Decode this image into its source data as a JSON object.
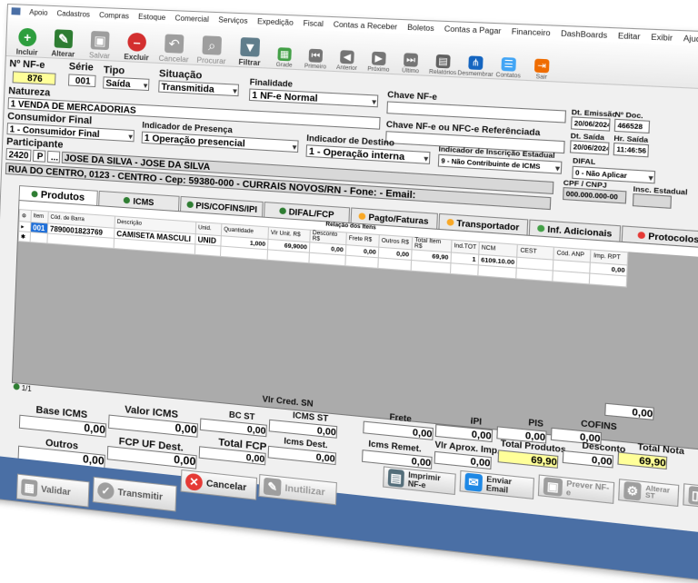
{
  "menu": [
    "Apoio",
    "Cadastros",
    "Compras",
    "Estoque",
    "Comercial",
    "Serviços",
    "Expedição",
    "Fiscal",
    "Contas a Receber",
    "Boletos",
    "Contas a Pagar",
    "Financeiro",
    "DashBoards",
    "Editar",
    "Exibir",
    "Ajuda"
  ],
  "toolbar": [
    {
      "label": "Incluir",
      "icon": "plus-icon",
      "color": "#2e9e3e"
    },
    {
      "label": "Alterar",
      "icon": "pencil-icon",
      "color": "#2e7d32"
    },
    {
      "label": "Salvar",
      "icon": "floppy-icon",
      "color": "#9e9e9e"
    },
    {
      "label": "Excluir",
      "icon": "delete-icon",
      "color": "#d32f2f"
    },
    {
      "label": "Cancelar",
      "icon": "undo-icon",
      "color": "#9e9e9e"
    },
    {
      "label": "Procurar",
      "icon": "search-icon",
      "color": "#9e9e9e"
    },
    {
      "label": "Filtrar",
      "icon": "funnel-icon",
      "color": "#607d8b"
    },
    {
      "label": "Grade",
      "icon": "grid-icon",
      "color": "#43a047"
    },
    {
      "label": "Primeiro",
      "icon": "first-icon",
      "color": "#757575"
    },
    {
      "label": "Anterior",
      "icon": "prev-icon",
      "color": "#757575"
    },
    {
      "label": "Próximo",
      "icon": "next-icon",
      "color": "#757575"
    },
    {
      "label": "Último",
      "icon": "last-icon",
      "color": "#757575"
    },
    {
      "label": "Relatórios",
      "icon": "report-icon",
      "color": "#616161"
    },
    {
      "label": "Desmembrar",
      "icon": "split-icon",
      "color": "#1565c0"
    },
    {
      "label": "Contatos",
      "icon": "contacts-icon",
      "color": "#42a5f5"
    },
    {
      "label": "Sair",
      "icon": "exit-icon",
      "color": "#ef6c00"
    }
  ],
  "header": {
    "nf_label": "Nº NF-e",
    "nf_value": "876",
    "serie_label": "Série",
    "serie_value": "001",
    "tipo_label": "Tipo",
    "tipo_value": "Saída",
    "situacao_label": "Situação",
    "situacao_value": "Transmitida",
    "finalidade_label": "Finalidade",
    "finalidade_value": "1  NF-e Normal",
    "chave_label": "Chave NF-e",
    "chave_value": "",
    "dt_emissao_label": "Dt. Emissão",
    "dt_emissao_value": "20/06/2024",
    "n_doc_label": "Nº Doc.",
    "n_doc_value": "466528",
    "dt_saida_label": "Dt. Saída",
    "dt_saida_value": "20/06/2024",
    "hr_saida_label": "Hr. Saída",
    "hr_saida_value": "11:46:56",
    "natureza_label": "Natureza",
    "natureza_value": "1  VENDA DE MERCADORIAS",
    "chave_ref_label": "Chave NF-e ou NFC-e Referênciada",
    "chave_ref_value": "",
    "consumidor_label": "Consumidor Final",
    "consumidor_value": "1 - Consumidor Final",
    "presenca_label": "Indicador de Presença",
    "presenca_value": "1  Operação presencial",
    "destino_label": "Indicador de Destino",
    "destino_value": "1 - Operação interna",
    "ie_label": "Indicador de Inscrição Estadual",
    "ie_value": "9 - Não Contribuinte de ICMS",
    "difal_label": "DIFAL",
    "difal_value": "0 - Não Aplicar",
    "participante_label": "Participante",
    "participante_code": "2420",
    "participante_type": "P",
    "participante_more": "...",
    "participante_name": "JOSE DA SILVA - JOSE DA SILVA",
    "cpf_label": "CPF / CNPJ",
    "cpf_value": "000.000.000-00",
    "insc_label": "Insc. Estadual",
    "insc_value": "",
    "address": "RUA DO CENTRO, 0123 - CENTRO  - Cep: 59380-000 - CURRAIS NOVOS/RN - Fone:  - Email:"
  },
  "tabs": [
    {
      "label": "Produtos",
      "color": "#2e7d32"
    },
    {
      "label": "ICMS",
      "color": "#2e7d32"
    },
    {
      "label": "PIS/COFINS/IPI",
      "color": "#2e7d32"
    },
    {
      "label": "DIFAL/FCP",
      "color": "#2e7d32"
    },
    {
      "label": "Pagto/Faturas",
      "color": "#f9a825"
    },
    {
      "label": "Transportador",
      "color": "#f9a825"
    },
    {
      "label": "Inf. Adicionais",
      "color": "#43a047"
    },
    {
      "label": "Protocolos",
      "color": "#e53935"
    }
  ],
  "grid": {
    "title": "Relação dos Itens",
    "columns": [
      "Item",
      "Cód. de Barra",
      "Descrição",
      "Unid.",
      "Quantidade",
      "Vlr Unit. R$",
      "Desconto R$",
      "Frete R$",
      "Outros R$",
      "Total Item R$",
      "Ind.TOT",
      "NCM",
      "CEST",
      "Cód. ANP",
      "Imp. RPT"
    ],
    "rows": [
      [
        "001",
        "7890001823769",
        "CAMISETA MASCULI",
        "UNID",
        "1,000",
        "69,9000",
        "0,00",
        "0,00",
        "0,00",
        "69,90",
        "1",
        "6109.10.00",
        "",
        "",
        "0,00"
      ]
    ],
    "record_count": "1/1"
  },
  "totals": {
    "base_icms_label": "Base ICMS",
    "base_icms": "0,00",
    "valor_icms_label": "Valor ICMS",
    "valor_icms": "0,00",
    "bc_st_label": "BC ST",
    "bc_st": "0,00",
    "icms_st_label": "ICMS ST",
    "icms_st": "0,00",
    "frete_label": "Frete",
    "frete": "0,00",
    "ipi_label": "IPI",
    "ipi": "0,00",
    "pis_label": "PIS",
    "pis": "0,00",
    "cofins_label": "COFINS",
    "cofins": "0,00",
    "vlr_cred_label": "Vlr Cred. SN",
    "vlr_cred": "0,00",
    "outros_label": "Outros",
    "outros": "0,00",
    "fcp_uf_label": "FCP UF Dest.",
    "fcp_uf": "0,00",
    "total_fcp_label": "Total FCP",
    "total_fcp": "0,00",
    "icms_dest_label": "Icms Dest.",
    "icms_dest": "0,00",
    "icms_remet_label": "Icms Remet.",
    "icms_remet": "0,00",
    "vlr_aprox_label": "Vlr Aprox. Imp.",
    "vlr_aprox": "0,00",
    "total_produtos_label": "Total Produtos",
    "total_produtos": "69,90",
    "desconto_label": "Desconto",
    "desconto": "0,00",
    "total_nota_label": "Total Nota",
    "total_nota": "69,90"
  },
  "actions": {
    "imprimir": "Imprimir NF-e",
    "enviar": "Enviar Email",
    "prever": "Prever NF-e",
    "alterar_st": "Alterar ST",
    "cancelar": "Cancelar",
    "inutilizar": "Inutilizar",
    "validar": "Validar",
    "transmitir": "Transmitir"
  }
}
